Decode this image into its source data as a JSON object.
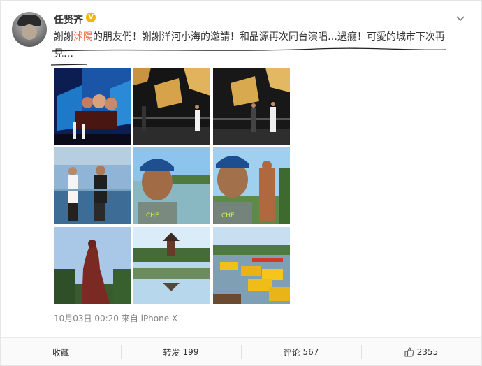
{
  "user": {
    "name": "任贤齐",
    "verified_badge": "V",
    "avatar_icon": "user-avatar"
  },
  "post": {
    "text_before": "謝謝",
    "link_text": "沭陽",
    "text_after": "的朋友們！謝謝洋河小海的邀請！和品源再次同台演唱…過癮！可愛的城市下次再見…",
    "link_color": "#eb7350"
  },
  "photos": [
    {
      "name": "photo-concert-screen"
    },
    {
      "name": "photo-stage-night-1"
    },
    {
      "name": "photo-stage-night-2"
    },
    {
      "name": "photo-rehearsal-stage"
    },
    {
      "name": "photo-selfie-lake"
    },
    {
      "name": "photo-selfie-statue"
    },
    {
      "name": "photo-statue-silhouette"
    },
    {
      "name": "photo-pavilion-lake"
    },
    {
      "name": "photo-boats-lake"
    }
  ],
  "meta": {
    "date": "10月03日 00:20",
    "from_label": "来自",
    "device": "iPhone X"
  },
  "actions": {
    "favorite": "收藏",
    "repost_label": "转发",
    "repost_count": "199",
    "comment_label": "评论",
    "comment_count": "567",
    "like_count": "2355"
  }
}
